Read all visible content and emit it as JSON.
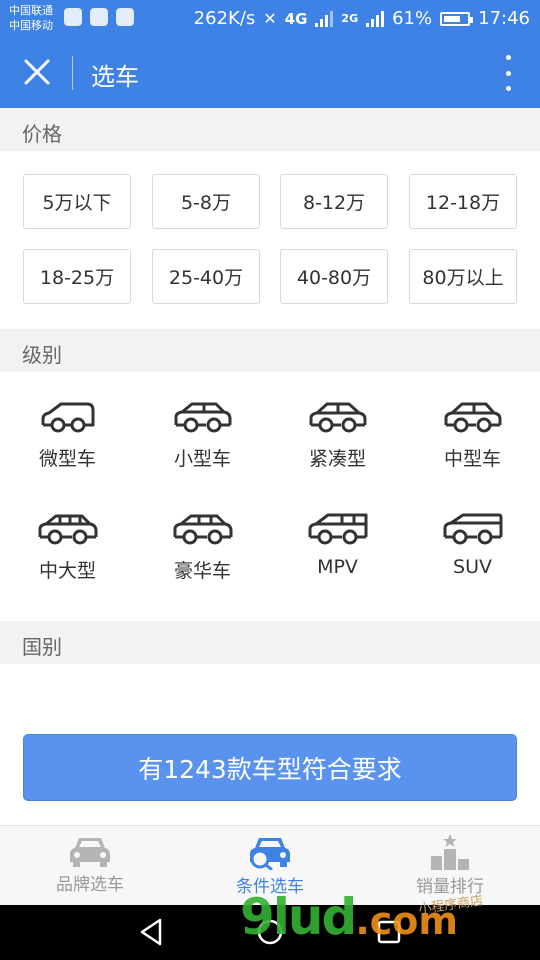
{
  "status_bar": {
    "carrier_1": "中国联通",
    "carrier_2": "中国移动",
    "net_speed": "262K/s",
    "network_1": "4G",
    "network_2": "2G",
    "battery": "61%",
    "time": "17:46"
  },
  "app_bar": {
    "title": "选车"
  },
  "price": {
    "header": "价格",
    "options": [
      "5万以下",
      "5-8万",
      "8-12万",
      "12-18万",
      "18-25万",
      "25-40万",
      "40-80万",
      "80万以上"
    ]
  },
  "class": {
    "header": "级别",
    "items": [
      {
        "label": "微型车",
        "icon": "micro-car-icon"
      },
      {
        "label": "小型车",
        "icon": "small-car-icon"
      },
      {
        "label": "紧凑型",
        "icon": "compact-car-icon"
      },
      {
        "label": "中型车",
        "icon": "midsize-car-icon"
      },
      {
        "label": "中大型",
        "icon": "large-car-icon"
      },
      {
        "label": "豪华车",
        "icon": "luxury-car-icon"
      },
      {
        "label": "MPV",
        "icon": "mpv-icon"
      },
      {
        "label": "SUV",
        "icon": "suv-icon"
      }
    ]
  },
  "country": {
    "header": "国别"
  },
  "result_button": "有1243款车型符合要求",
  "tabs": [
    {
      "label": "品牌选车",
      "icon": "car-front-icon",
      "active": false
    },
    {
      "label": "条件选车",
      "icon": "car-search-icon",
      "active": true
    },
    {
      "label": "销量排行",
      "icon": "ranking-podium-icon",
      "active": false
    }
  ],
  "watermark": {
    "text": "9lud",
    "suffix": ".com",
    "small": "小程序商店"
  },
  "colors": {
    "primary": "#3d82e4",
    "button": "#5a93ed",
    "section_bg": "#f2f2f2"
  }
}
